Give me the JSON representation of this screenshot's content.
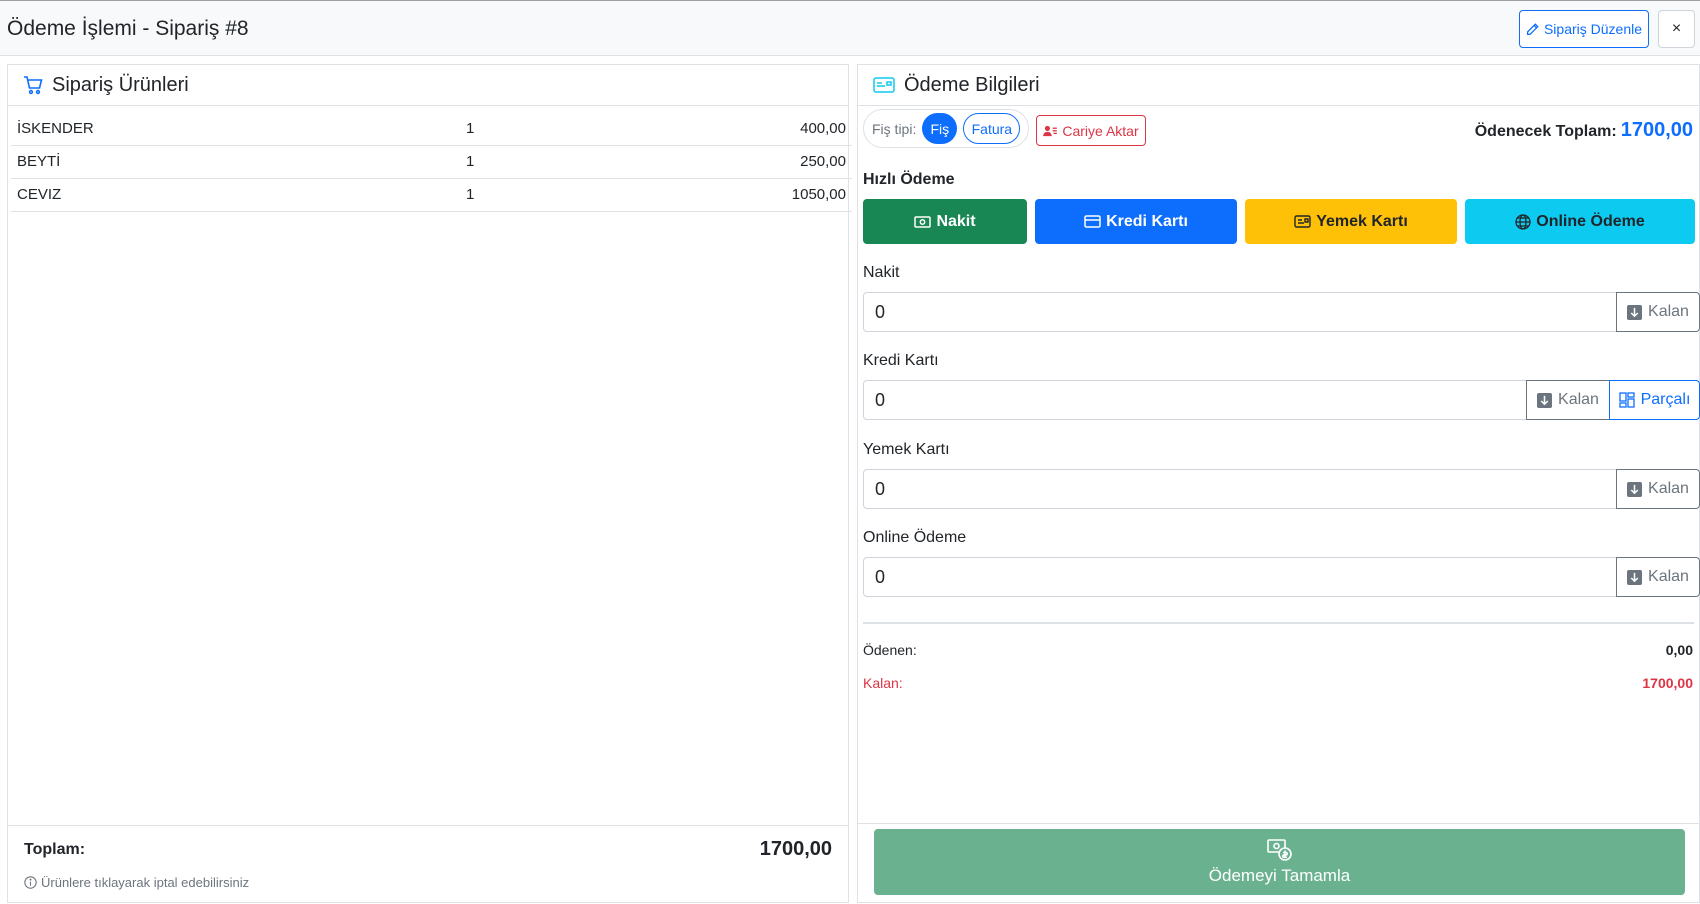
{
  "modal": {
    "title": "Ödeme İşlemi - Sipariş #8",
    "edit_label": "Sipariş Düzenle",
    "close_label": "×"
  },
  "products": {
    "title": "Sipariş Ürünleri",
    "rows": [
      {
        "name": "İSKENDER",
        "qty": "1",
        "price": "400,00"
      },
      {
        "name": "BEYTİ",
        "qty": "1",
        "price": "250,00"
      },
      {
        "name": "CEVIZ",
        "qty": "1",
        "price": "1050,00"
      }
    ],
    "total_label": "Toplam:",
    "total_value": "1700,00",
    "hint": "Ürünlere tıklayarak iptal edebilirsiniz"
  },
  "payment": {
    "title": "Ödeme Bilgileri",
    "receipt_type_label": "Fiş tipi:",
    "receipt_options": [
      "Fiş",
      "Fatura"
    ],
    "receipt_selected": "Fiş",
    "cariye_label": "Cariye Aktar",
    "payable_label": "Ödenecek Toplam:",
    "payable_value": "1700,00",
    "quick_title": "Hızlı Ödeme",
    "quick_buttons": {
      "cash": "Nakit",
      "credit": "Kredi Kartı",
      "meal": "Yemek Kartı",
      "online": "Online Ödeme"
    },
    "fields": {
      "cash": {
        "label": "Nakit",
        "value": "0",
        "remaining_label": "Kalan"
      },
      "credit": {
        "label": "Kredi Kartı",
        "value": "0",
        "remaining_label": "Kalan",
        "split_label": "Parçalı"
      },
      "meal": {
        "label": "Yemek Kartı",
        "value": "0",
        "remaining_label": "Kalan"
      },
      "online": {
        "label": "Online Ödeme",
        "value": "0",
        "remaining_label": "Kalan"
      }
    },
    "paid_label": "Ödenen:",
    "paid_value": "0,00",
    "remaining_label": "Kalan:",
    "remaining_value": "1700,00",
    "complete_label": "Ödemeyi Tamamla"
  },
  "colors": {
    "primary": "#0d6efd",
    "success": "#198754",
    "warning": "#ffc107",
    "info": "#0dcaf0",
    "danger": "#dc3545",
    "complete": "#6ab190"
  }
}
